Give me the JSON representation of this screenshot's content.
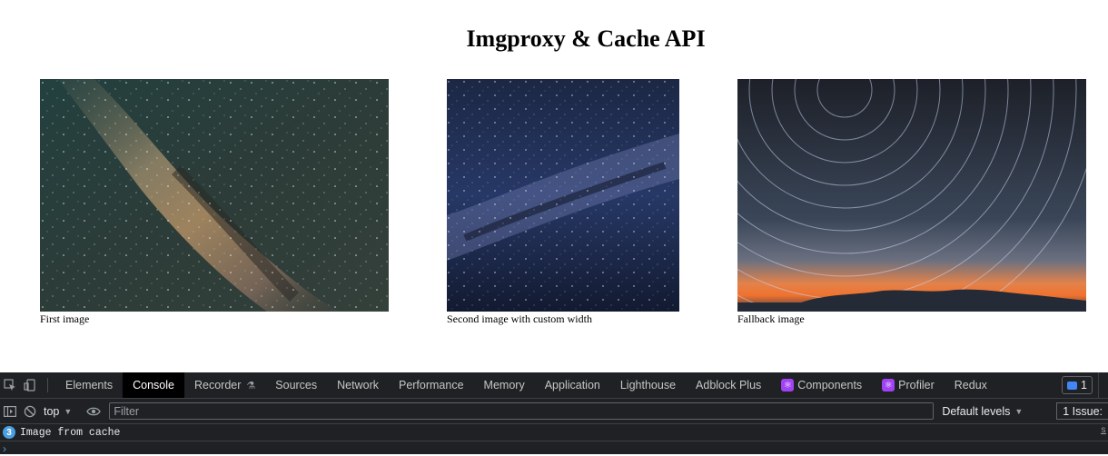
{
  "page": {
    "title": "Imgproxy & Cache API",
    "figures": [
      {
        "caption": "First image"
      },
      {
        "caption": "Second image with custom width"
      },
      {
        "caption": "Fallback image"
      }
    ]
  },
  "devtools": {
    "tabs": [
      "Elements",
      "Console",
      "Recorder",
      "Sources",
      "Network",
      "Performance",
      "Memory",
      "Application",
      "Lighthouse",
      "Adblock Plus",
      "Components",
      "Profiler",
      "Redux"
    ],
    "active_tab": "Console",
    "issues_badge_count": "1",
    "toolbar": {
      "context": "top",
      "filter_placeholder": "Filter",
      "levels": "Default levels",
      "issues_label": "1 Issue:"
    },
    "log": [
      {
        "count": "3",
        "message": "Image from cache",
        "source": "s"
      }
    ],
    "prompt": "›"
  }
}
